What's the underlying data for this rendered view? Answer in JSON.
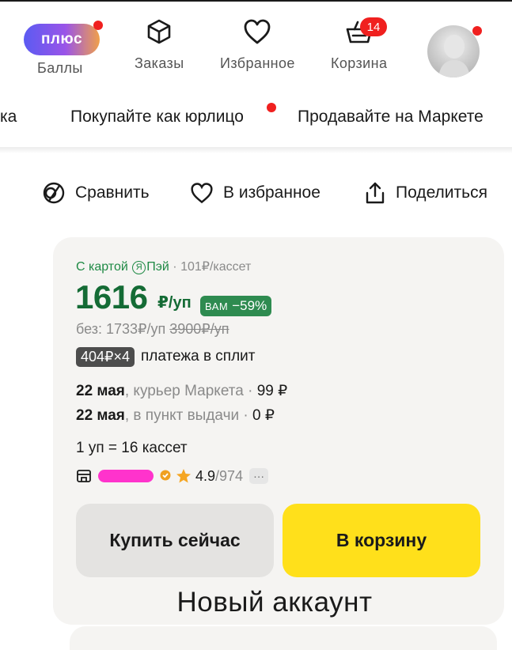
{
  "header": {
    "plus": {
      "badge": "плюс",
      "label": "Баллы"
    },
    "orders": {
      "label": "Заказы",
      "icon": "box-icon"
    },
    "favorites": {
      "label": "Избранное",
      "icon": "heart-icon"
    },
    "cart": {
      "label": "Корзина",
      "count": "14",
      "icon": "basket-icon"
    },
    "profile": {
      "icon": "avatar"
    }
  },
  "subnav": {
    "partial": "ка",
    "business": "Покупайте как юрлицо",
    "sell": "Продавайте на Маркете"
  },
  "actions": {
    "compare": "Сравнить",
    "favorite": "В избранное",
    "share": "Поделиться"
  },
  "product": {
    "pay_prefix": "С картой",
    "pay_name": "Пэй",
    "pay_per_item": "· 101₽/кассет",
    "price": "1616",
    "price_unit": "₽/уп",
    "discount_label": "ВАМ",
    "discount": "−59%",
    "without_label": "без: 1733₽/уп",
    "old_price": "3900₽/уп",
    "split_badge": "404₽×4",
    "split_text": "платежа в сплит",
    "delivery": [
      {
        "date": "22 мая",
        "method": ", курьер Маркета",
        "sep": " · ",
        "price": "99 ₽"
      },
      {
        "date": "22 мая",
        "method": ", в пункт выдачи",
        "sep": " · ",
        "price": "0 ₽"
      }
    ],
    "pack": "1 уп = 16 кассет",
    "rating": "4.9",
    "reviews": "/974",
    "more": "···"
  },
  "buttons": {
    "buy_now": "Купить сейчас",
    "add_to_cart": "В корзину"
  },
  "caption": "Новый аккаунт",
  "colors": {
    "green": "#146b35",
    "yellow": "#ffe01b",
    "red": "#f0201f"
  }
}
